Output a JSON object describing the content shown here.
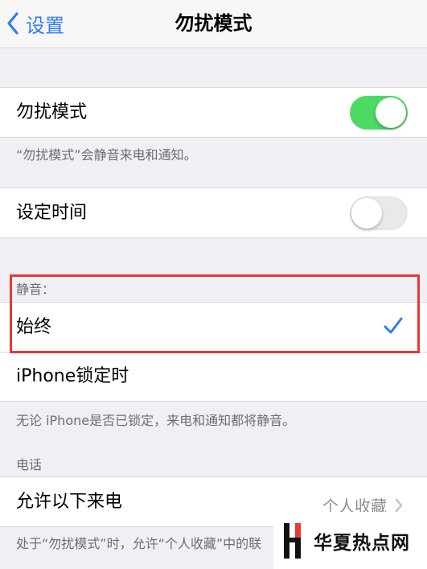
{
  "nav": {
    "back_label": "设置",
    "title": "勿扰模式"
  },
  "dnd": {
    "label": "勿扰模式",
    "enabled": true,
    "footer": "“勿扰模式”会静音来电和通知。"
  },
  "scheduled": {
    "label": "设定时间",
    "enabled": false
  },
  "silence": {
    "header": "静音：",
    "options": [
      {
        "label": "始终",
        "selected": true
      },
      {
        "label": "iPhone锁定时",
        "selected": false
      }
    ],
    "footer": "无论 iPhone是否已锁定，来电和通知都将静音。"
  },
  "phone": {
    "header": "电话",
    "allow_calls_label": "允许以下来电",
    "allow_calls_value": "个人收藏",
    "footer": "处于“勿扰模式”时，允许“个人收藏”中的联"
  },
  "watermark": {
    "text": "华夏热点网"
  },
  "colors": {
    "accent": "#2f7cf6",
    "toggle_on": "#4cd964",
    "highlight": "#e53935"
  }
}
